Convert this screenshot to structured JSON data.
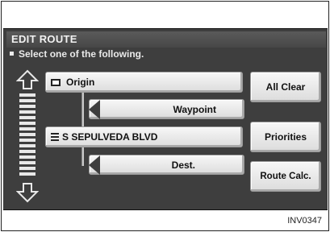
{
  "title": "EDIT ROUTE",
  "instruction": "Select one of the following.",
  "route_rows": {
    "origin": "Origin",
    "waypoint": "Waypoint",
    "street": "S SEPULVEDA BLVD",
    "dest": "Dest."
  },
  "side_buttons": {
    "all_clear": "All Clear",
    "priorities": "Priorities",
    "route_calc": "Route Calc."
  },
  "figure_code": "INV0347",
  "icons": {
    "scroll_up": "up-arrow-icon",
    "scroll_down": "down-arrow-icon",
    "origin": "flag-icon",
    "street": "street-icon"
  }
}
